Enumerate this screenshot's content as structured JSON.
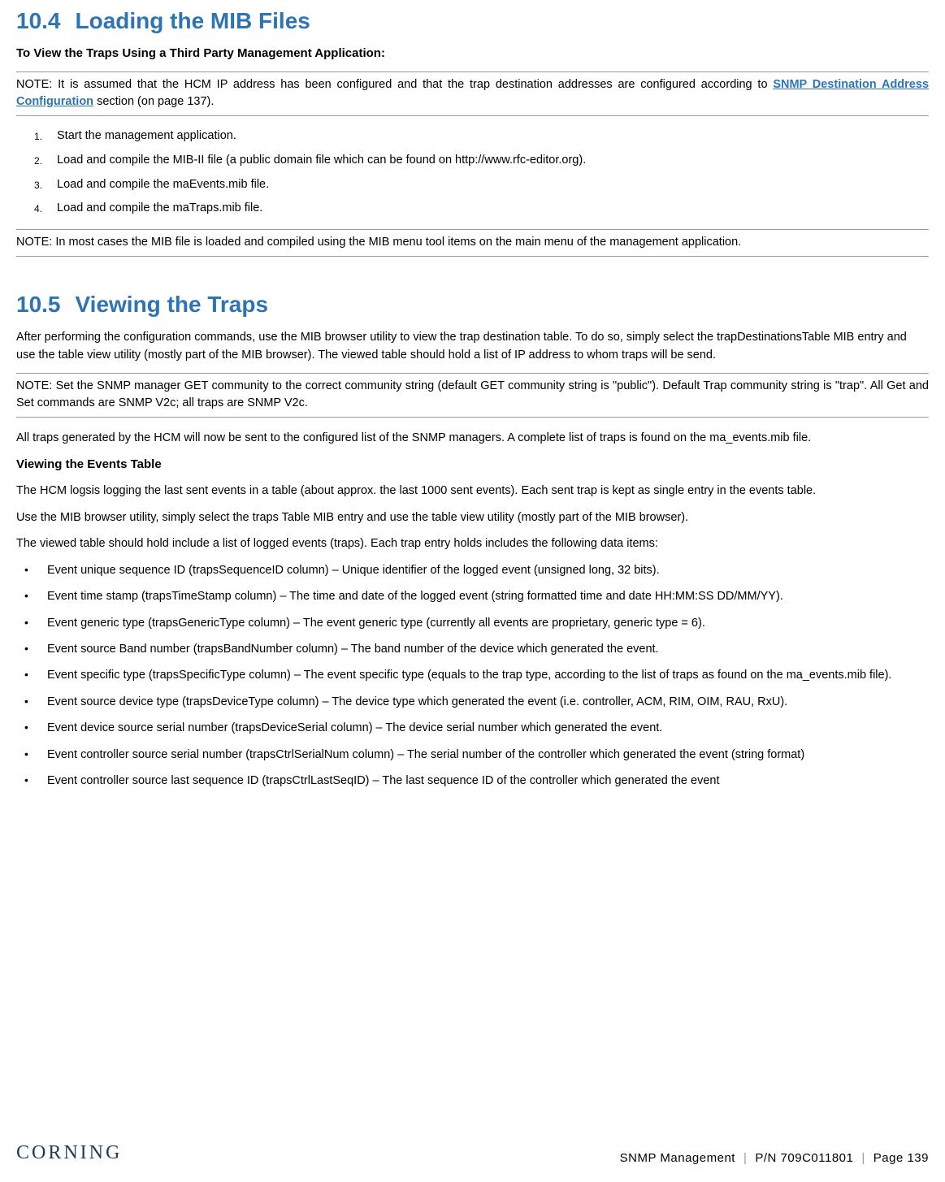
{
  "section104": {
    "number": "10.4",
    "title": "Loading the MIB Files",
    "subheading": "To View the Traps Using a Third Party Management Application:",
    "note1_pre": "NOTE: It is assumed that the HCM IP address has been configured and that the trap destination addresses are configured according to ",
    "note1_link": "SNMP Destination Address Configuration",
    "note1_post": " section (on page 137).",
    "steps": [
      "Start the management application.",
      "Load and compile the MIB-II file (a public domain file which can be found on http://www.rfc-editor.org).",
      "Load and compile the maEvents.mib file.",
      "Load and compile the maTraps.mib file."
    ],
    "note2": "NOTE: In most cases the MIB file is loaded and compiled using the MIB menu tool items on the main menu of the management application."
  },
  "section105": {
    "number": "10.5",
    "title": "Viewing the Traps",
    "intro": "After performing the configuration commands, use the MIB browser utility to view the trap destination table. To do so, simply select the trapDestinationsTable MIB entry and use the table view utility (mostly part of the MIB browser). The viewed table should hold a list of IP address to whom traps will be send.",
    "note": "NOTE: Set the SNMP manager GET community to the correct community string (default GET community string is \"public\"). Default Trap community string is \"trap\". All Get and Set commands are SNMP V2c; all traps are SNMP V2c.",
    "para2": "All traps generated by the HCM will now be sent to the configured list of the SNMP managers. A complete list of traps is found on the ma_events.mib file.",
    "events_heading": "Viewing the Events Table",
    "events_p1": "The HCM logsis logging the last sent events in a table (about approx. the last 1000 sent events). Each sent trap is kept as single entry in the events table.",
    "events_p2": "Use the MIB browser utility, simply select the traps Table MIB entry and use the table view utility (mostly part of the MIB browser).",
    "events_p3": "The viewed table should hold include a list of logged events (traps). Each trap entry holds includes the following data items:",
    "bullets": [
      "Event unique sequence ID (trapsSequenceID column) – Unique identifier of the logged event (unsigned long, 32 bits).",
      "Event time stamp (trapsTimeStamp column) – The time and date of the logged event (string formatted time and date HH:MM:SS DD/MM/YY).",
      "Event generic type (trapsGenericType column) – The event generic type (currently all events are proprietary, generic type = 6).",
      "Event source Band number (trapsBandNumber column) – The band number of the device which generated the event.",
      "Event specific type (trapsSpecificType column) – The event specific type (equals to the trap type, according to the list of traps as found on the ma_events.mib file).",
      "Event source device type (trapsDeviceType column) – The device type which generated the event (i.e. controller, ACM, RIM, OIM, RAU, RxU).",
      "Event device source serial number (trapsDeviceSerial column) – The device serial number which generated the event.",
      "Event controller source serial number (trapsCtrlSerialNum column) – The serial number of the controller which generated the event (string format)",
      "Event controller source last sequence ID (trapsCtrlLastSeqID) – The last sequence ID of the controller which generated the event"
    ]
  },
  "footer": {
    "brand": "CORNING",
    "chapter": "SNMP Management",
    "pn": "P/N 709C011801",
    "page": "Page 139"
  }
}
